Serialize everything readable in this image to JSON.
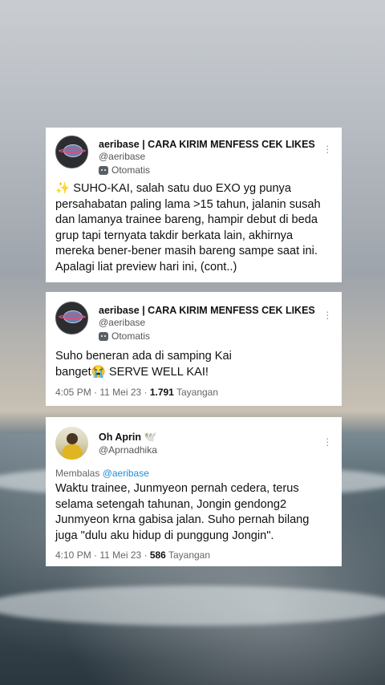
{
  "tweets": [
    {
      "name": "aeribase | CARA KIRIM MENFESS CEK LIKES",
      "handle": "@aeribase",
      "label": "Otomatis",
      "text": "✨ SUHO-KAI, salah satu duo EXO yg punya persahabatan paling lama >15 tahun, jalanin susah dan lamanya trainee bareng, hampir debut di beda grup tapi ternyata takdir berkata lain, akhirnya mereka bener-bener masih bareng sampe saat ini. Apalagi liat preview hari ini,  (cont..)"
    },
    {
      "name": "aeribase | CARA KIRIM MENFESS CEK LIKES",
      "handle": "@aeribase",
      "label": "Otomatis",
      "text": "Suho beneran ada di samping Kai banget😭 SERVE WELL KAI!",
      "meta_time": "4:05 PM · 11 Mei 23 · ",
      "meta_views": "1.791",
      "meta_views_label": " Tayangan"
    },
    {
      "name": "Oh Aprin 🕊️",
      "handle": "@Aprnadhika",
      "reply_prefix": "Membalas ",
      "reply_to": "@aeribase",
      "text": "Waktu trainee, Junmyeon pernah cedera, terus selama setengah tahunan, Jongin gendong2 Junmyeon krna gabisa jalan. Suho pernah bilang juga \"dulu aku hidup di punggung Jongin\".",
      "meta_time": "4:10 PM · 11 Mei 23 · ",
      "meta_views": "586",
      "meta_views_label": " Tayangan"
    }
  ]
}
